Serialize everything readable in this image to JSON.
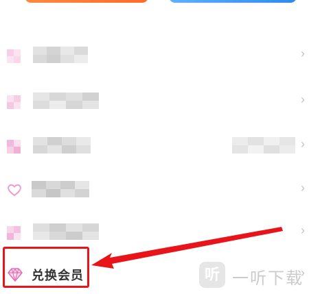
{
  "menu": {
    "items": [
      {
        "label": "",
        "blurred": true
      },
      {
        "label": "",
        "blurred": true
      },
      {
        "label": "",
        "blurred": true
      },
      {
        "label": "",
        "blurred": true
      },
      {
        "label": "",
        "blurred": true
      },
      {
        "label": "兑换会员",
        "icon": "diamond-icon"
      }
    ]
  },
  "watermark": {
    "logo": "听",
    "text": "一听下载"
  },
  "colors": {
    "accent_red": "#e8141a",
    "icon_pink": "#f29ad0",
    "orange": "#ff7a33",
    "blue": "#3a94f2"
  }
}
